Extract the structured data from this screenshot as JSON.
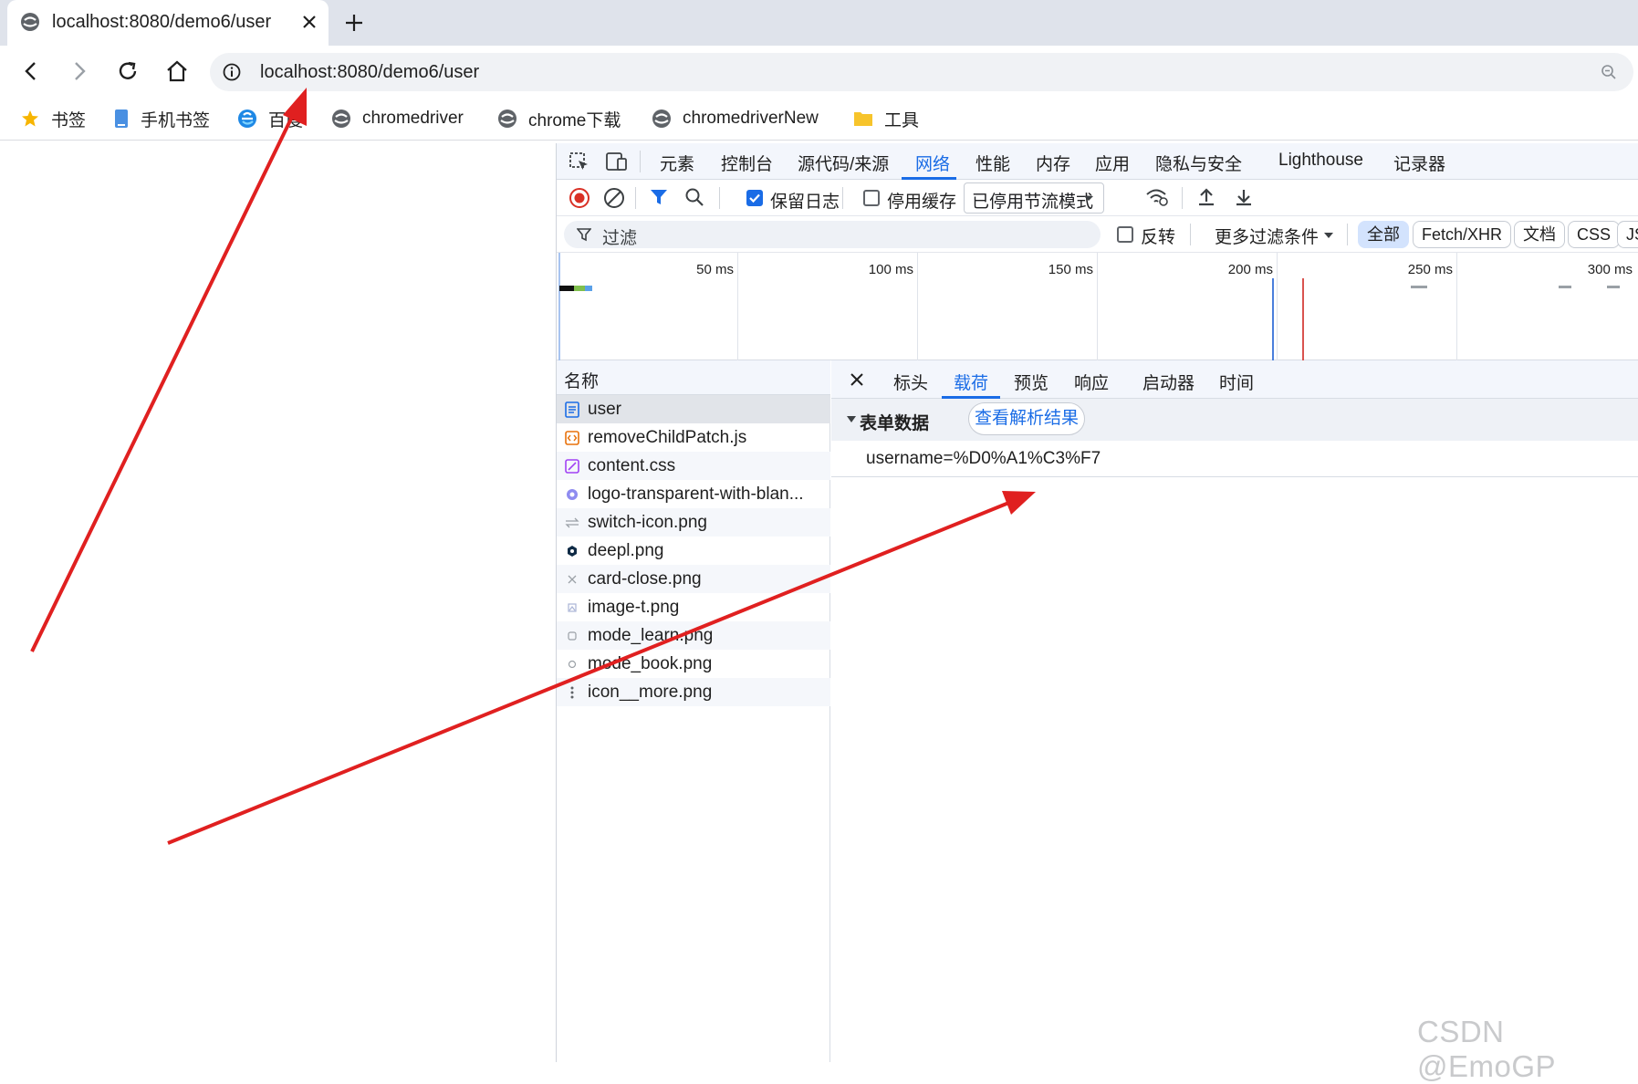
{
  "browser": {
    "tab": {
      "title": "localhost:8080/demo6/user"
    },
    "address": {
      "url": "localhost:8080/demo6/user"
    },
    "bookmarks": [
      {
        "label": "书签",
        "icon": "star-icon"
      },
      {
        "label": "手机书签",
        "icon": "phone-icon"
      },
      {
        "label": "百度",
        "icon": "edge-icon"
      },
      {
        "label": "chromedriver",
        "icon": "chrome-site-icon"
      },
      {
        "label": "chrome下载",
        "icon": "chrome-site-icon"
      },
      {
        "label": "chromedriverNew",
        "icon": "chrome-site-icon"
      },
      {
        "label": "工具",
        "icon": "folder-icon"
      }
    ]
  },
  "devtools": {
    "panels": [
      "元素",
      "控制台",
      "源代码/来源",
      "网络",
      "性能",
      "内存",
      "应用",
      "隐私与安全",
      "Lighthouse",
      "记录器"
    ],
    "active_panel": "网络",
    "toolbar": {
      "preserve_log_label": "保留日志",
      "preserve_log_checked": true,
      "disable_cache_label": "停用缓存",
      "disable_cache_checked": false,
      "throttle_value": "已停用节流模式"
    },
    "filter": {
      "placeholder": "过滤",
      "invert_label": "反转",
      "more_filters_label": "更多过滤条件",
      "types": [
        "全部",
        "Fetch/XHR",
        "文档",
        "CSS",
        "JS"
      ],
      "active_type": "全部"
    },
    "timeline": {
      "ticks": [
        "50 ms",
        "100 ms",
        "150 ms",
        "200 ms",
        "250 ms",
        "300 ms"
      ]
    },
    "requests": {
      "header": "名称",
      "items": [
        {
          "name": "user",
          "icon": "document-icon"
        },
        {
          "name": "removeChildPatch.js",
          "icon": "script-icon"
        },
        {
          "name": "content.css",
          "icon": "stylesheet-icon"
        },
        {
          "name": "logo-transparent-with-blan...",
          "icon": "image-icon"
        },
        {
          "name": "switch-icon.png",
          "icon": "image-icon"
        },
        {
          "name": "deepl.png",
          "icon": "image-icon"
        },
        {
          "name": "card-close.png",
          "icon": "image-icon"
        },
        {
          "name": "image-t.png",
          "icon": "image-icon"
        },
        {
          "name": "mode_learn.png",
          "icon": "image-icon"
        },
        {
          "name": "mode_book.png",
          "icon": "image-icon"
        },
        {
          "name": "icon__more.png",
          "icon": "image-icon"
        }
      ],
      "selected": "user"
    },
    "detail": {
      "tabs": [
        "标头",
        "载荷",
        "预览",
        "响应",
        "启动器",
        "时间"
      ],
      "active_tab": "载荷",
      "section_title": "表单数据",
      "parse_button": "查看解析结果",
      "form_data": "username=%D0%A1%C3%F7"
    }
  },
  "watermark": "CSDN @EmoGP",
  "colors": {
    "accent": "#1a6ce6",
    "annotation_arrow": "#e02020"
  }
}
